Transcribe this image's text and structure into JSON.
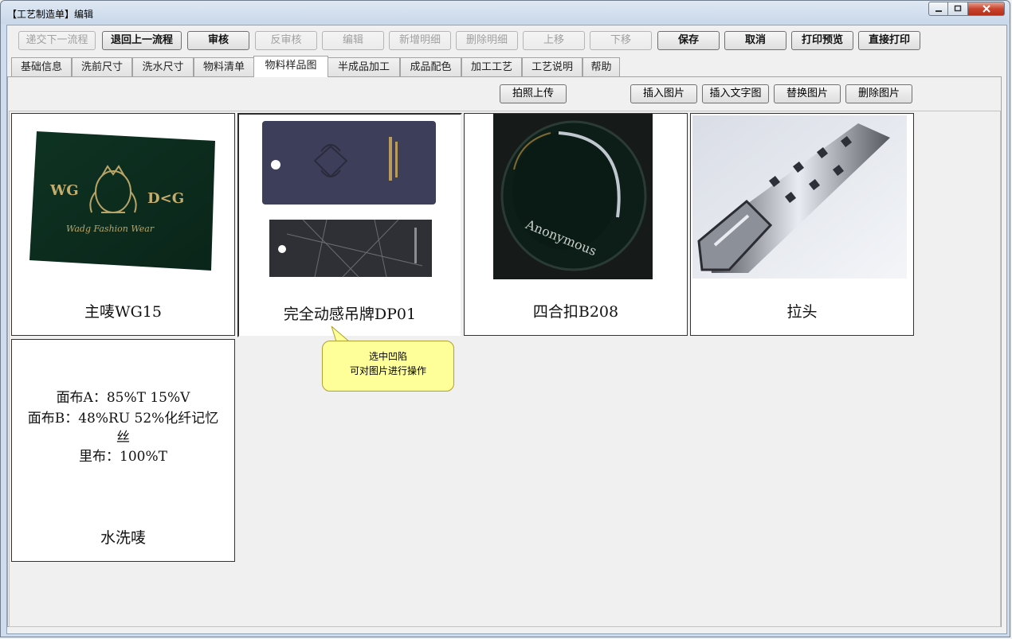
{
  "window": {
    "title": "【工艺制造单】编辑",
    "min_icon": "minimize-icon",
    "max_icon": "maximize-icon",
    "close_icon": "close-icon"
  },
  "toolbar": {
    "submit_next": "递交下一流程",
    "return_prev": "退回上一流程",
    "approve": "审核",
    "unapprove": "反审核",
    "edit": "编辑",
    "add_detail": "新增明细",
    "delete_detail": "删除明细",
    "move_up": "上移",
    "move_down": "下移",
    "save": "保存",
    "cancel": "取消",
    "print_preview": "打印预览",
    "print_direct": "直接打印"
  },
  "tabs": [
    "基础信息",
    "洗前尺寸",
    "洗水尺寸",
    "物料清单",
    "物料样品图",
    "半成品加工",
    "成品配色",
    "加工工艺",
    "工艺说明",
    "帮助"
  ],
  "active_tab": "物料样品图",
  "image_toolbar": {
    "photo_upload": "拍照上传",
    "insert_image": "插入图片",
    "insert_text_image": "插入文字图",
    "replace_image": "替换图片",
    "delete_image": "删除图片"
  },
  "cards": [
    {
      "caption": "主唛WG15",
      "label_text_left": "WG",
      "label_text_right": "D<G",
      "label_script": "Wadg Fashion Wear"
    },
    {
      "caption": "完全动感吊牌DP01"
    },
    {
      "caption": "四合扣B208",
      "button_text": "Anonymous"
    },
    {
      "caption": "拉头"
    },
    {
      "caption": "水洗唛",
      "text_lines": [
        "面布A：85%T 15%V",
        "面布B：48%RU 52%化纤记忆",
        "丝",
        "里布：100%T"
      ]
    }
  ],
  "tooltip": {
    "line1": "选中凹陷",
    "line2": "可对图片进行操作"
  }
}
